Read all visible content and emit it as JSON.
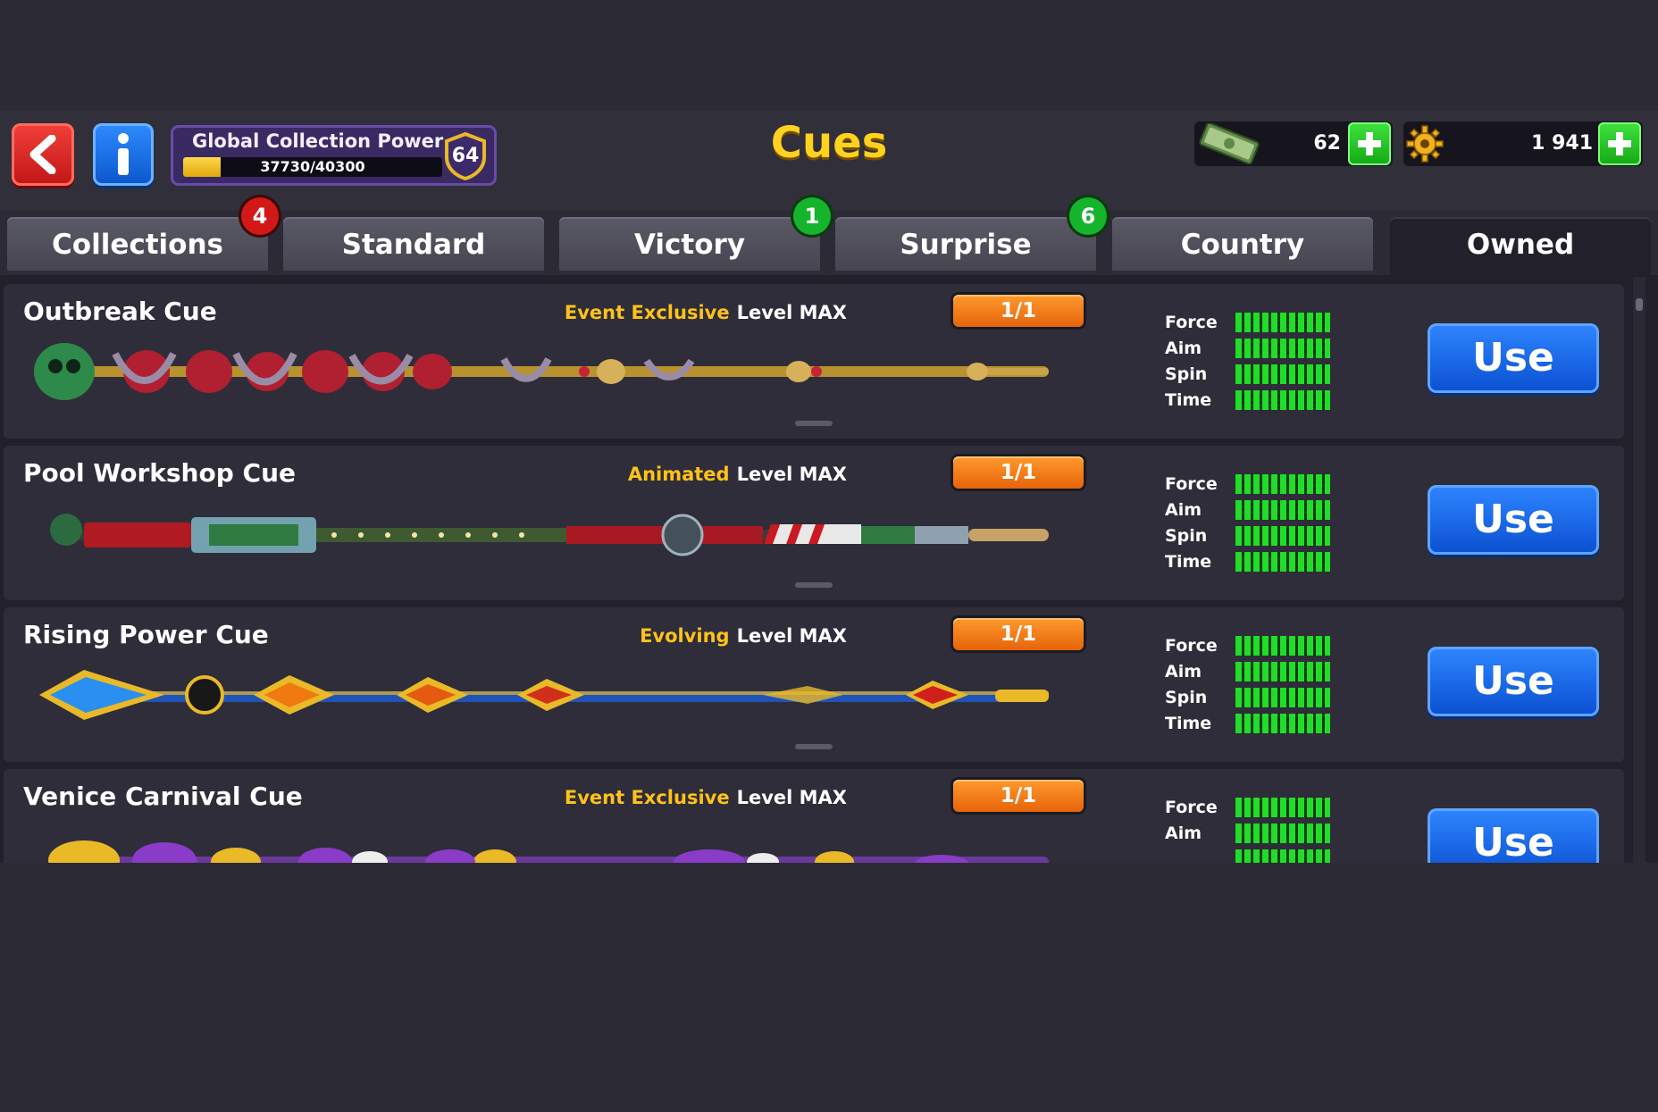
{
  "header": {
    "back_icon": "chevron-left-icon",
    "info_icon": "info-icon",
    "title": "Cues",
    "collection_power": {
      "label": "Global Collection Power",
      "value_text": "37730/40300",
      "current": 37730,
      "max": 40300,
      "level": "64"
    },
    "currencies": {
      "cash": {
        "icon": "cash-icon",
        "amount": "62"
      },
      "coins": {
        "icon": "coin-gear-icon",
        "amount": "1 941"
      }
    }
  },
  "tabs": [
    {
      "label": "Collections",
      "badge": "4",
      "badge_color": "#d31818",
      "active": false
    },
    {
      "label": "Standard",
      "badge": "",
      "active": false
    },
    {
      "label": "Victory",
      "badge": "1",
      "badge_color": "#16b42c",
      "active": false
    },
    {
      "label": "Surprise",
      "badge": "6",
      "badge_color": "#16b42c",
      "active": false
    },
    {
      "label": "Country",
      "badge": "",
      "active": false
    },
    {
      "label": "Owned",
      "badge": "",
      "active": true
    }
  ],
  "cues": [
    {
      "name": "Outbreak Cue",
      "tag": "Event Exclusive",
      "level": "Level MAX",
      "count": "1/1",
      "stats": [
        {
          "label": "Force"
        },
        {
          "label": "Aim"
        },
        {
          "label": "Spin"
        },
        {
          "label": "Time"
        }
      ],
      "action": "Use"
    },
    {
      "name": "Pool Workshop Cue",
      "tag": "Animated",
      "level": "Level MAX",
      "count": "1/1",
      "stats": [
        {
          "label": "Force"
        },
        {
          "label": "Aim"
        },
        {
          "label": "Spin"
        },
        {
          "label": "Time"
        }
      ],
      "action": "Use"
    },
    {
      "name": "Rising Power Cue",
      "tag": "Evolving",
      "level": "Level MAX",
      "count": "1/1",
      "stats": [
        {
          "label": "Force"
        },
        {
          "label": "Aim"
        },
        {
          "label": "Spin"
        },
        {
          "label": "Time"
        }
      ],
      "action": "Use"
    },
    {
      "name": "Venice Carnival Cue",
      "tag": "Event Exclusive",
      "level": "Level MAX",
      "count": "1/1",
      "stats": [
        {
          "label": "Force"
        },
        {
          "label": "Aim"
        }
      ],
      "action": "Use"
    }
  ],
  "colors": {
    "accent_title": "#ffd21f",
    "tag_special": "#ffc21a",
    "use_button": "#1763e6",
    "stat_green": "#22dc2a"
  }
}
